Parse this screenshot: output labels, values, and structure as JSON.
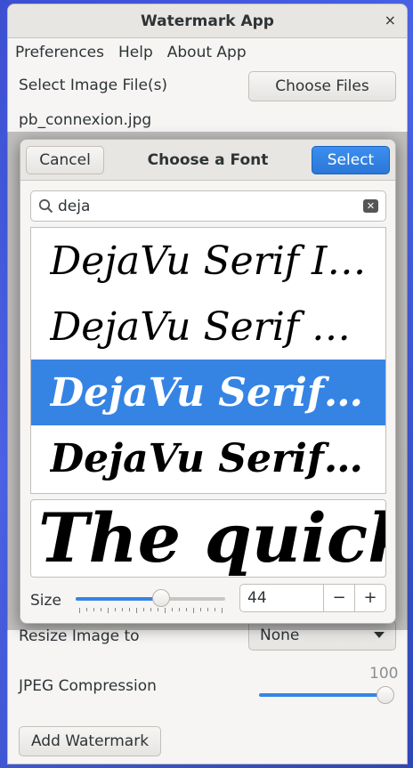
{
  "window": {
    "title": "Watermark App",
    "close": "×"
  },
  "menu": [
    "Preferences",
    "Help",
    "About App"
  ],
  "main": {
    "select_files_label": "Select Image File(s)",
    "choose_files_button": "Choose Files",
    "file_name": "pb_connexion.jpg",
    "resize_label": "Resize Image to",
    "resize_value": "None",
    "jpeg_label": "JPEG Compression",
    "jpeg_value": "100",
    "jpeg_level": 1.0,
    "add_watermark_button": "Add Watermark"
  },
  "dialog": {
    "title": "Choose a Font",
    "cancel": "Cancel",
    "select": "Select",
    "search_value": "deja",
    "fonts": [
      {
        "label": "DejaVu Serif Italic",
        "style": "italic"
      },
      {
        "label": "DejaVu Serif Condensed Italic",
        "style": "italic"
      },
      {
        "label": "DejaVu Serif Bold Italic",
        "style": "bold-italic",
        "selected": true
      },
      {
        "label": "DejaVu Serif Bold Condensed Italic",
        "style": "bold-italic"
      }
    ],
    "preview_text": "The quick",
    "size_label": "Size",
    "size_value": "44",
    "size_level": 0.57,
    "minus": "−",
    "plus": "+"
  },
  "colors": {
    "accent": "#3584e4",
    "bg": "#f6f5f4"
  }
}
